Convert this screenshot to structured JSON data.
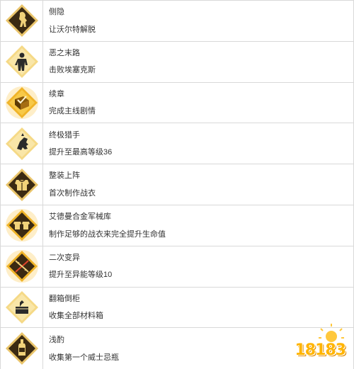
{
  "achievements": [
    {
      "title": "侧隐",
      "desc": "让沃尔特解脱",
      "icon": "bigfoot-icon",
      "frame": "dark",
      "inner": "#3b2a12"
    },
    {
      "title": "恶之末路",
      "desc": "击败埃塞克斯",
      "icon": "silhouette-icon",
      "frame": "gold",
      "inner": "#f4d37a"
    },
    {
      "title": "续章",
      "desc": "完成主线剧情",
      "icon": "book-check-icon",
      "frame": "glow",
      "inner": "#f4b22a"
    },
    {
      "title": "终极猎手",
      "desc": "提升至最高等级36",
      "icon": "hunter-skull-icon",
      "frame": "gold",
      "inner": "#f4d37a"
    },
    {
      "title": "整装上阵",
      "desc": "首次制作战衣",
      "icon": "armor-icon",
      "frame": "dark",
      "inner": "#3b2a12"
    },
    {
      "title": "艾德曼合金军械库",
      "desc": "制作足够的战衣来完全提升生命值",
      "icon": "armory-icon",
      "frame": "glow",
      "inner": "#3b2a12"
    },
    {
      "title": "二次变异",
      "desc": "提升至异能等级10",
      "icon": "dna-icon",
      "frame": "glow",
      "inner": "#3b2a12"
    },
    {
      "title": "翻箱倒柜",
      "desc": "收集全部材料箱",
      "icon": "crate-icon",
      "frame": "gold",
      "inner": "#f4d37a"
    },
    {
      "title": "浅酌",
      "desc": "收集第一个威士忌瓶",
      "icon": "whiskey-bottle-icon",
      "frame": "dark",
      "inner": "#3b2a12"
    }
  ],
  "watermark": {
    "text": "18183"
  }
}
